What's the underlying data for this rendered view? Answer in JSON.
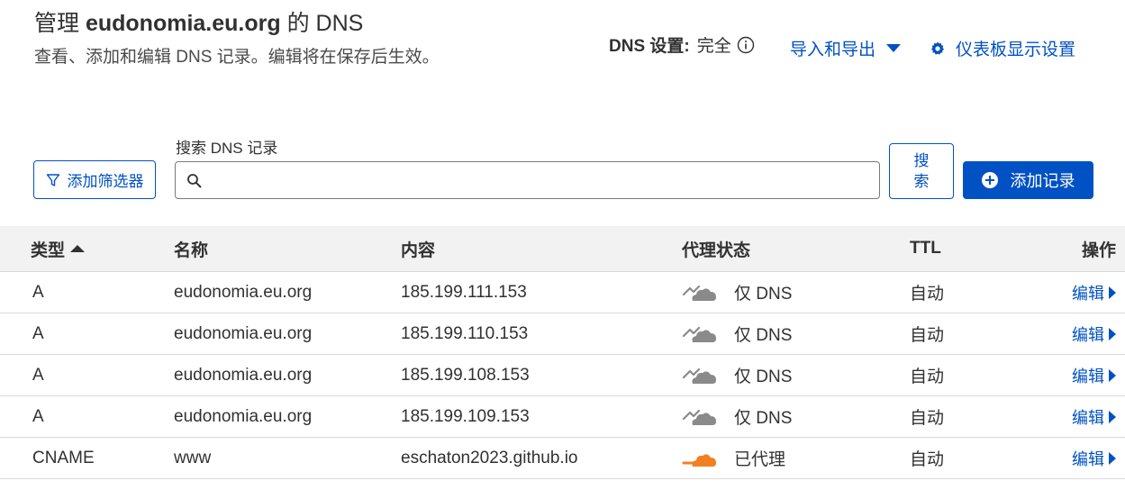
{
  "header": {
    "title_prefix": "管理 ",
    "title_domain": "eudonomia.eu.org",
    "title_suffix": " 的 DNS",
    "subtitle": "查看、添加和编辑 DNS 记录。编辑将在保存后生效。",
    "dns_settings_label": "DNS 设置:",
    "dns_settings_value": "完全",
    "import_export_label": "导入和导出",
    "dashboard_settings_label": "仪表板显示设置"
  },
  "toolbar": {
    "filter_label": "添加筛选器",
    "search_label": "搜索 DNS 记录",
    "search_value": "",
    "search_button_label": "搜索",
    "add_record_label": "添加记录"
  },
  "table": {
    "columns": {
      "type": "类型",
      "name": "名称",
      "content": "内容",
      "proxy": "代理状态",
      "ttl": "TTL",
      "actions": "操作"
    },
    "rows": [
      {
        "type": "A",
        "name": "eudonomia.eu.org",
        "content": "185.199.111.153",
        "proxy": "仅 DNS",
        "proxied": false,
        "ttl": "自动",
        "action": "编辑"
      },
      {
        "type": "A",
        "name": "eudonomia.eu.org",
        "content": "185.199.110.153",
        "proxy": "仅 DNS",
        "proxied": false,
        "ttl": "自动",
        "action": "编辑"
      },
      {
        "type": "A",
        "name": "eudonomia.eu.org",
        "content": "185.199.108.153",
        "proxy": "仅 DNS",
        "proxied": false,
        "ttl": "自动",
        "action": "编辑"
      },
      {
        "type": "A",
        "name": "eudonomia.eu.org",
        "content": "185.199.109.153",
        "proxy": "仅 DNS",
        "proxied": false,
        "ttl": "自动",
        "action": "编辑"
      },
      {
        "type": "CNAME",
        "name": "www",
        "content": "eschaton2023.github.io",
        "proxy": "已代理",
        "proxied": true,
        "ttl": "自动",
        "action": "编辑"
      }
    ]
  },
  "colors": {
    "accent": "#0051c3",
    "proxied_cloud": "#f38020",
    "dns_only_cloud": "#8a8a8a"
  },
  "icons": {
    "info": "info-icon",
    "caret": "caret-down-icon",
    "gear": "gear-icon",
    "filter": "filter-icon",
    "search": "search-icon",
    "add": "plus-circle-icon",
    "sort": "sort-asc-icon",
    "dns_only": "cloud-dns-only-icon",
    "proxied": "cloud-proxied-icon",
    "edit_caret": "caret-right-icon"
  }
}
